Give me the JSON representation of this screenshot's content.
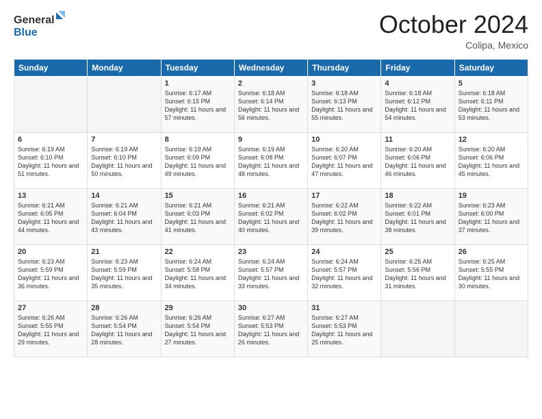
{
  "header": {
    "logo_line1": "General",
    "logo_line2": "Blue",
    "month": "October 2024",
    "location": "Colipa, Mexico"
  },
  "days_of_week": [
    "Sunday",
    "Monday",
    "Tuesday",
    "Wednesday",
    "Thursday",
    "Friday",
    "Saturday"
  ],
  "weeks": [
    [
      {
        "day": "",
        "empty": true
      },
      {
        "day": "",
        "empty": true
      },
      {
        "day": "1",
        "sunrise": "6:17 AM",
        "sunset": "6:15 PM",
        "daylight": "11 hours and 57 minutes."
      },
      {
        "day": "2",
        "sunrise": "6:18 AM",
        "sunset": "6:14 PM",
        "daylight": "11 hours and 56 minutes."
      },
      {
        "day": "3",
        "sunrise": "6:18 AM",
        "sunset": "6:13 PM",
        "daylight": "11 hours and 55 minutes."
      },
      {
        "day": "4",
        "sunrise": "6:18 AM",
        "sunset": "6:12 PM",
        "daylight": "11 hours and 54 minutes."
      },
      {
        "day": "5",
        "sunrise": "6:18 AM",
        "sunset": "6:11 PM",
        "daylight": "11 hours and 53 minutes."
      }
    ],
    [
      {
        "day": "6",
        "sunrise": "6:19 AM",
        "sunset": "6:10 PM",
        "daylight": "11 hours and 51 minutes."
      },
      {
        "day": "7",
        "sunrise": "6:19 AM",
        "sunset": "6:10 PM",
        "daylight": "11 hours and 50 minutes."
      },
      {
        "day": "8",
        "sunrise": "6:19 AM",
        "sunset": "6:09 PM",
        "daylight": "11 hours and 49 minutes."
      },
      {
        "day": "9",
        "sunrise": "6:19 AM",
        "sunset": "6:08 PM",
        "daylight": "11 hours and 48 minutes."
      },
      {
        "day": "10",
        "sunrise": "6:20 AM",
        "sunset": "6:07 PM",
        "daylight": "11 hours and 47 minutes."
      },
      {
        "day": "11",
        "sunrise": "6:20 AM",
        "sunset": "6:06 PM",
        "daylight": "11 hours and 46 minutes."
      },
      {
        "day": "12",
        "sunrise": "6:20 AM",
        "sunset": "6:06 PM",
        "daylight": "11 hours and 45 minutes."
      }
    ],
    [
      {
        "day": "13",
        "sunrise": "6:21 AM",
        "sunset": "6:05 PM",
        "daylight": "11 hours and 44 minutes."
      },
      {
        "day": "14",
        "sunrise": "6:21 AM",
        "sunset": "6:04 PM",
        "daylight": "11 hours and 43 minutes."
      },
      {
        "day": "15",
        "sunrise": "6:21 AM",
        "sunset": "6:03 PM",
        "daylight": "11 hours and 41 minutes."
      },
      {
        "day": "16",
        "sunrise": "6:21 AM",
        "sunset": "6:02 PM",
        "daylight": "11 hours and 40 minutes."
      },
      {
        "day": "17",
        "sunrise": "6:22 AM",
        "sunset": "6:02 PM",
        "daylight": "11 hours and 39 minutes."
      },
      {
        "day": "18",
        "sunrise": "6:22 AM",
        "sunset": "6:01 PM",
        "daylight": "11 hours and 38 minutes."
      },
      {
        "day": "19",
        "sunrise": "6:23 AM",
        "sunset": "6:00 PM",
        "daylight": "11 hours and 37 minutes."
      }
    ],
    [
      {
        "day": "20",
        "sunrise": "6:23 AM",
        "sunset": "5:59 PM",
        "daylight": "11 hours and 36 minutes."
      },
      {
        "day": "21",
        "sunrise": "6:23 AM",
        "sunset": "5:59 PM",
        "daylight": "11 hours and 35 minutes."
      },
      {
        "day": "22",
        "sunrise": "6:24 AM",
        "sunset": "5:58 PM",
        "daylight": "11 hours and 34 minutes."
      },
      {
        "day": "23",
        "sunrise": "6:24 AM",
        "sunset": "5:57 PM",
        "daylight": "11 hours and 33 minutes."
      },
      {
        "day": "24",
        "sunrise": "6:24 AM",
        "sunset": "5:57 PM",
        "daylight": "11 hours and 32 minutes."
      },
      {
        "day": "25",
        "sunrise": "6:25 AM",
        "sunset": "5:56 PM",
        "daylight": "11 hours and 31 minutes."
      },
      {
        "day": "26",
        "sunrise": "6:25 AM",
        "sunset": "5:55 PM",
        "daylight": "11 hours and 30 minutes."
      }
    ],
    [
      {
        "day": "27",
        "sunrise": "6:26 AM",
        "sunset": "5:55 PM",
        "daylight": "11 hours and 29 minutes."
      },
      {
        "day": "28",
        "sunrise": "6:26 AM",
        "sunset": "5:54 PM",
        "daylight": "11 hours and 28 minutes."
      },
      {
        "day": "29",
        "sunrise": "6:26 AM",
        "sunset": "5:54 PM",
        "daylight": "11 hours and 27 minutes."
      },
      {
        "day": "30",
        "sunrise": "6:27 AM",
        "sunset": "5:53 PM",
        "daylight": "11 hours and 26 minutes."
      },
      {
        "day": "31",
        "sunrise": "6:27 AM",
        "sunset": "5:53 PM",
        "daylight": "11 hours and 25 minutes."
      },
      {
        "day": "",
        "empty": true
      },
      {
        "day": "",
        "empty": true
      }
    ]
  ],
  "labels": {
    "sunrise_prefix": "Sunrise: ",
    "sunset_prefix": "Sunset: ",
    "daylight_prefix": "Daylight: "
  }
}
